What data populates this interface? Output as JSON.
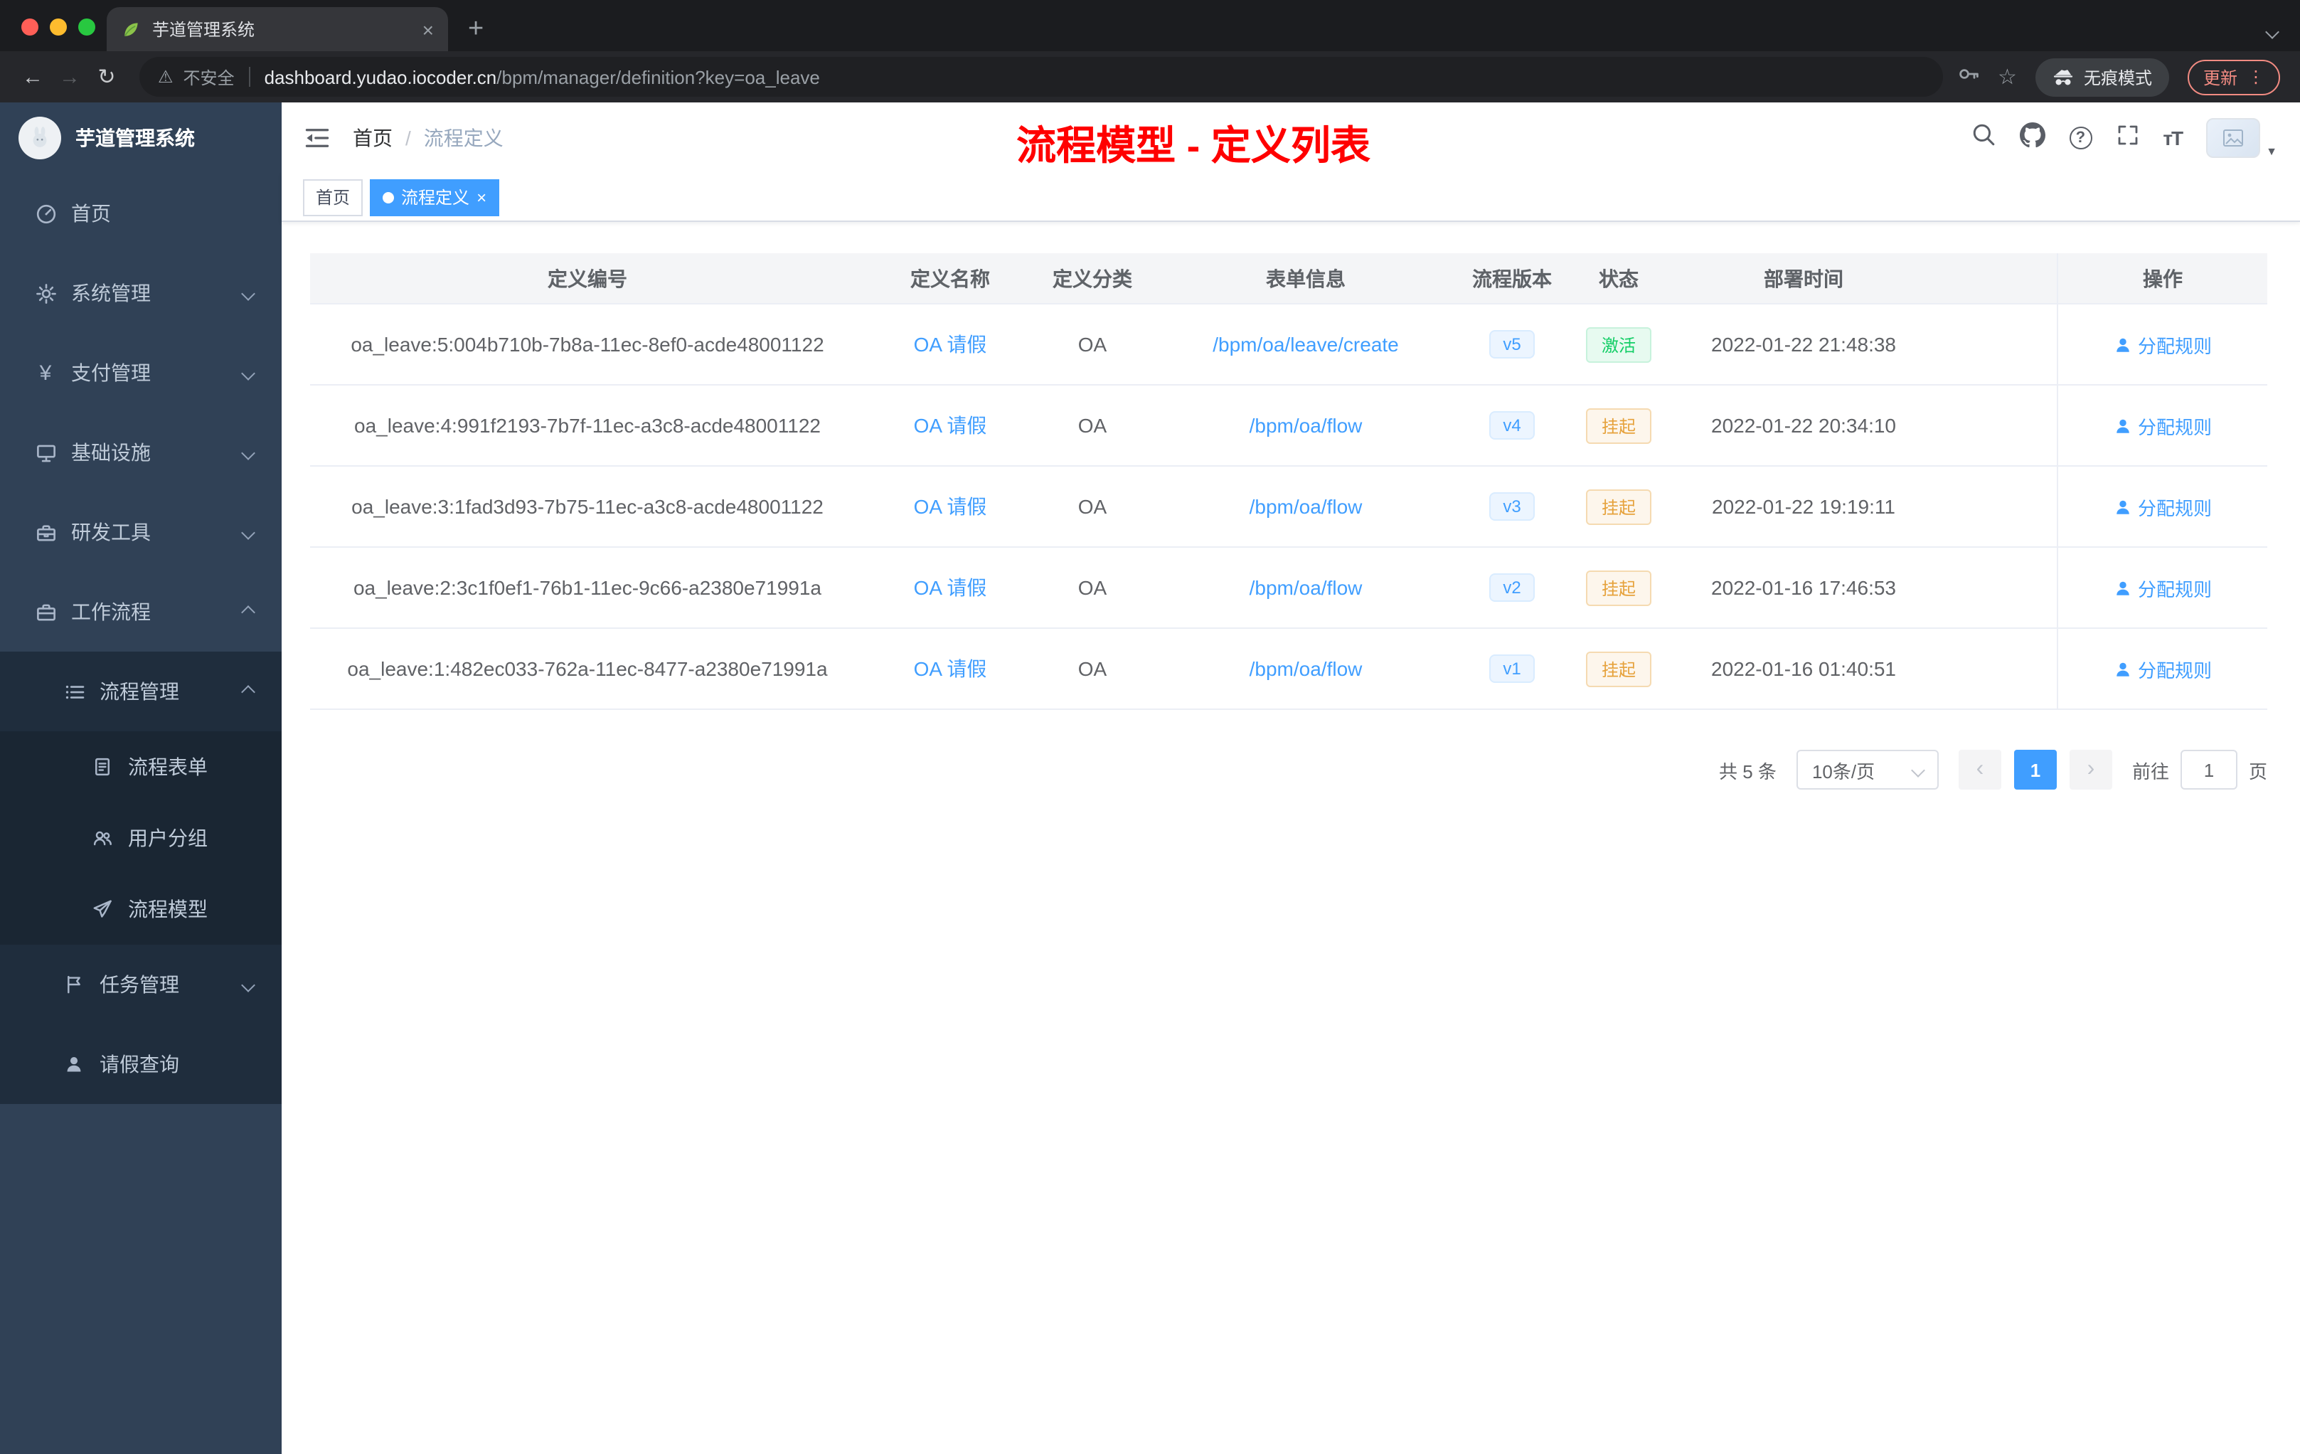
{
  "colors": {
    "accent": "#409eff",
    "success": "#13ce66",
    "warning": "#e6a23c",
    "annotation_red": "#ff0000",
    "sidebar_bg": "#304156",
    "sidebar_sub_bg": "#1f2d3d",
    "table_header_bg": "#f4f5f7"
  },
  "icons": {
    "close": "×",
    "plus": "+",
    "back": "←",
    "forward": "→",
    "reload": "↻",
    "warning": "⚠",
    "star": "☆",
    "dots": "⋮",
    "help": "?",
    "font_size": "тT",
    "caret": "▼",
    "prev": "‹",
    "next": "›"
  },
  "browser": {
    "tab_title": "芋道管理系统",
    "security_label": "不安全",
    "url_host": "dashboard.yudao.iocoder.cn",
    "url_path": "/bpm/manager/definition?key=oa_leave",
    "incognito_label": "无痕模式",
    "update_label": "更新"
  },
  "sidebar": {
    "logo_title": "芋道管理系统",
    "items": [
      {
        "label": "首页"
      },
      {
        "label": "系统管理"
      },
      {
        "label": "支付管理"
      },
      {
        "label": "基础设施"
      },
      {
        "label": "研发工具"
      },
      {
        "label": "工作流程"
      },
      {
        "label": "流程管理"
      },
      {
        "label": "流程表单"
      },
      {
        "label": "用户分组"
      },
      {
        "label": "流程模型"
      },
      {
        "label": "任务管理"
      },
      {
        "label": "请假查询"
      }
    ]
  },
  "header": {
    "breadcrumb_home": "首页",
    "breadcrumb_sep": "/",
    "breadcrumb_current": "流程定义",
    "annotation": "流程模型 - 定义列表"
  },
  "tags": {
    "home": "首页",
    "active": "流程定义"
  },
  "table": {
    "columns": [
      "定义编号",
      "定义名称",
      "定义分类",
      "表单信息",
      "流程版本",
      "状态",
      "部署时间",
      "操作"
    ],
    "rows": [
      {
        "id": "oa_leave:5:004b710b-7b8a-11ec-8ef0-acde48001122",
        "name": "OA 请假",
        "category": "OA",
        "form": "/bpm/oa/leave/create",
        "version": "v5",
        "status": "激活",
        "status_type": "success",
        "time": "2022-01-22 21:48:38",
        "action": "分配规则"
      },
      {
        "id": "oa_leave:4:991f2193-7b7f-11ec-a3c8-acde48001122",
        "name": "OA 请假",
        "category": "OA",
        "form": "/bpm/oa/flow",
        "version": "v4",
        "status": "挂起",
        "status_type": "warning",
        "time": "2022-01-22 20:34:10",
        "action": "分配规则"
      },
      {
        "id": "oa_leave:3:1fad3d93-7b75-11ec-a3c8-acde48001122",
        "name": "OA 请假",
        "category": "OA",
        "form": "/bpm/oa/flow",
        "version": "v3",
        "status": "挂起",
        "status_type": "warning",
        "time": "2022-01-22 19:19:11",
        "action": "分配规则"
      },
      {
        "id": "oa_leave:2:3c1f0ef1-76b1-11ec-9c66-a2380e71991a",
        "name": "OA 请假",
        "category": "OA",
        "form": "/bpm/oa/flow",
        "version": "v2",
        "status": "挂起",
        "status_type": "warning",
        "time": "2022-01-16 17:46:53",
        "action": "分配规则"
      },
      {
        "id": "oa_leave:1:482ec033-762a-11ec-8477-a2380e71991a",
        "name": "OA 请假",
        "category": "OA",
        "form": "/bpm/oa/flow",
        "version": "v1",
        "status": "挂起",
        "status_type": "warning",
        "time": "2022-01-16 01:40:51",
        "action": "分配规则"
      }
    ]
  },
  "pagination": {
    "total": "共 5 条",
    "page_size": "10条/页",
    "current": "1",
    "goto_label": "前往",
    "goto_value": "1",
    "unit": "页"
  }
}
